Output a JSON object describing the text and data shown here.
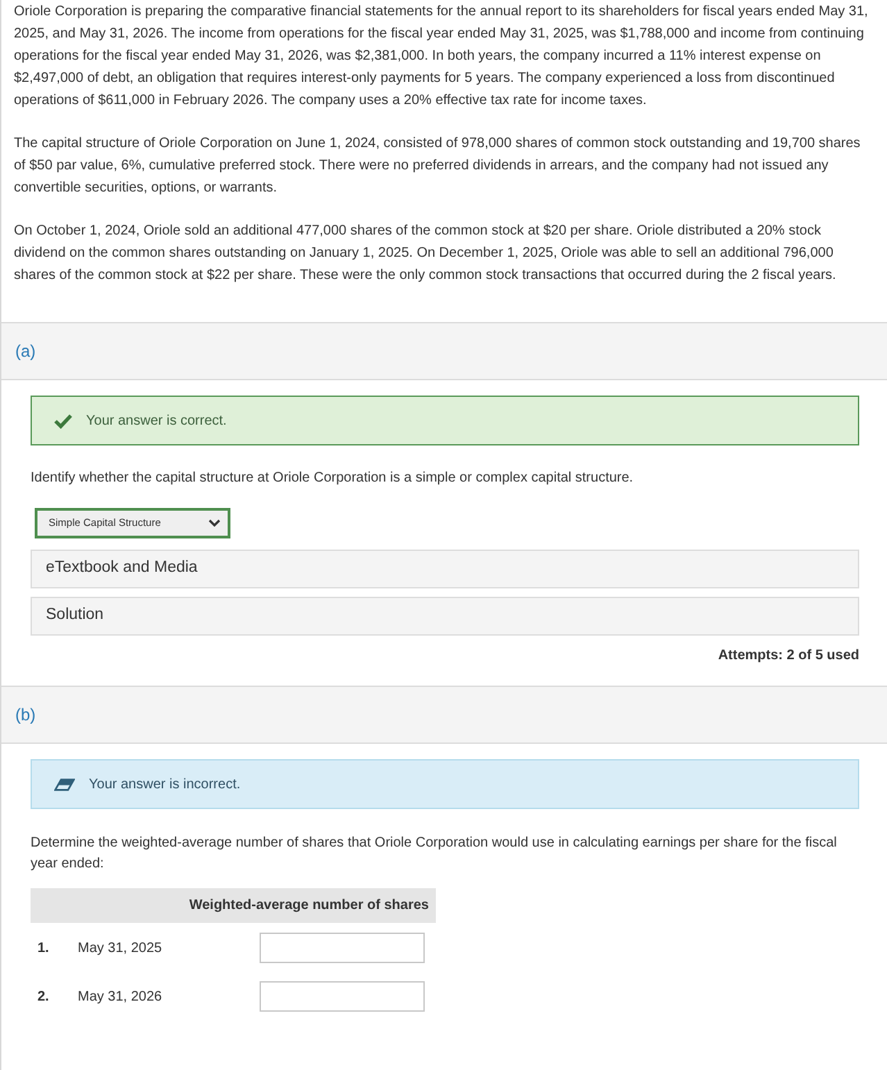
{
  "problem": {
    "paragraphs": [
      "Oriole Corporation is preparing the comparative financial statements for the annual report to its shareholders for fiscal years ended May 31, 2025, and May 31, 2026. The income from operations for the fiscal year ended May 31, 2025, was $1,788,000 and income from continuing operations for the fiscal year ended May 31, 2026, was $2,381,000. In both years, the company incurred a 11% interest expense on $2,497,000 of debt, an obligation that requires interest-only payments for 5 years. The company experienced a loss from discontinued operations of $611,000 in February 2026. The company uses a 20% effective tax rate for income taxes.",
      "The capital structure of Oriole Corporation on June 1, 2024, consisted of 978,000 shares of common stock outstanding and 19,700 shares of $50 par value, 6%, cumulative preferred stock. There were no preferred dividends in arrears, and the company had not issued any convertible securities, options, or warrants.",
      "On October 1, 2024, Oriole sold an additional 477,000 shares of the common stock at $20 per share. Oriole distributed a 20% stock dividend on the common shares outstanding on January 1, 2025. On December 1, 2025, Oriole was able to sell an additional 796,000 shares of the common stock at $22 per share. These were the only common stock transactions that occurred during the 2 fiscal years."
    ]
  },
  "parts": [
    {
      "label": "(a)",
      "feedback": {
        "kind": "correct",
        "message": "Your answer is correct."
      },
      "question": "Identify whether the capital structure at Oriole Corporation is a simple or complex capital structure.",
      "dropdown": {
        "value": "Simple Capital Structure"
      },
      "resources": [
        "eTextbook and Media",
        "Solution"
      ],
      "attempts": "Attempts: 2 of 5 used"
    },
    {
      "label": "(b)",
      "feedback": {
        "kind": "incorrect",
        "message": "Your answer is incorrect."
      },
      "question": "Determine the weighted-average number of shares that Oriole Corporation would use in calculating earnings per share for the fiscal year ended:",
      "table": {
        "columns": [
          "Weighted-average number of shares"
        ],
        "rows": [
          {
            "number": "1.",
            "label": "May 31, 2025"
          },
          {
            "number": "2.",
            "label": "May 31, 2026"
          }
        ]
      }
    }
  ]
}
